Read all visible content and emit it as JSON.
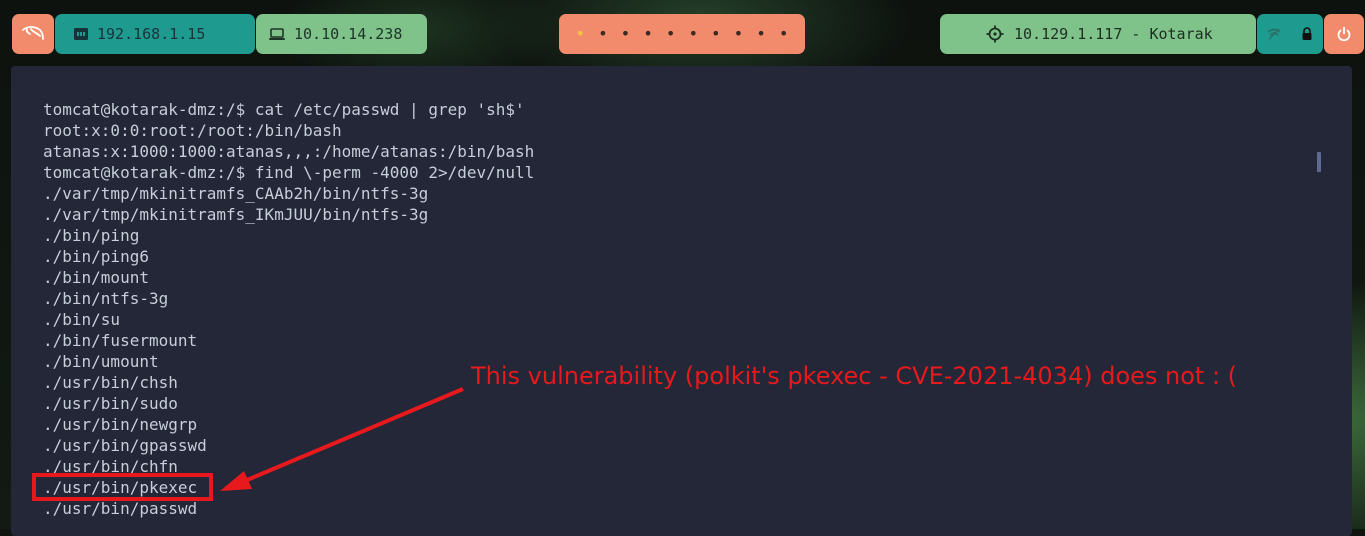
{
  "topbar": {
    "lan_ip": "192.168.1.15",
    "vpn_ip": "10.10.14.238",
    "workspaces": [
      "•",
      "•",
      "•",
      "•",
      "•",
      "•",
      "•",
      "•",
      "•",
      "•"
    ],
    "active_workspace": 0,
    "target": "10.129.1.117 - Kotarak",
    "icons": {
      "launcher": "kali-dragon-icon",
      "lan": "ethernet-icon",
      "vpn": "laptop-icon",
      "target": "crosshair-icon",
      "network": "network-off-icon",
      "lock": "lock-icon",
      "power": "power-icon"
    },
    "colors": {
      "orange": "#f28b6c",
      "teal": "#1f9a8f",
      "green": "#7fc38a"
    }
  },
  "terminal": {
    "lines": [
      "tomcat@kotarak-dmz:/$ cat /etc/passwd | grep 'sh$'",
      "root:x:0:0:root:/root:/bin/bash",
      "atanas:x:1000:1000:atanas,,,:/home/atanas:/bin/bash",
      "tomcat@kotarak-dmz:/$ find \\-perm -4000 2>/dev/null",
      "./var/tmp/mkinitramfs_CAAb2h/bin/ntfs-3g",
      "./var/tmp/mkinitramfs_IKmJUU/bin/ntfs-3g",
      "./bin/ping",
      "./bin/ping6",
      "./bin/mount",
      "./bin/ntfs-3g",
      "./bin/su",
      "./bin/fusermount",
      "./bin/umount",
      "./usr/bin/chsh",
      "./usr/bin/sudo",
      "./usr/bin/newgrp",
      "./usr/bin/gpasswd",
      "./usr/bin/chfn",
      "./usr/bin/pkexec",
      "./usr/bin/passwd"
    ]
  },
  "annotation": {
    "text": "This vulnerability (polkit's pkexec - CVE-2021-4034) does not : (",
    "color": "#e8191c"
  }
}
